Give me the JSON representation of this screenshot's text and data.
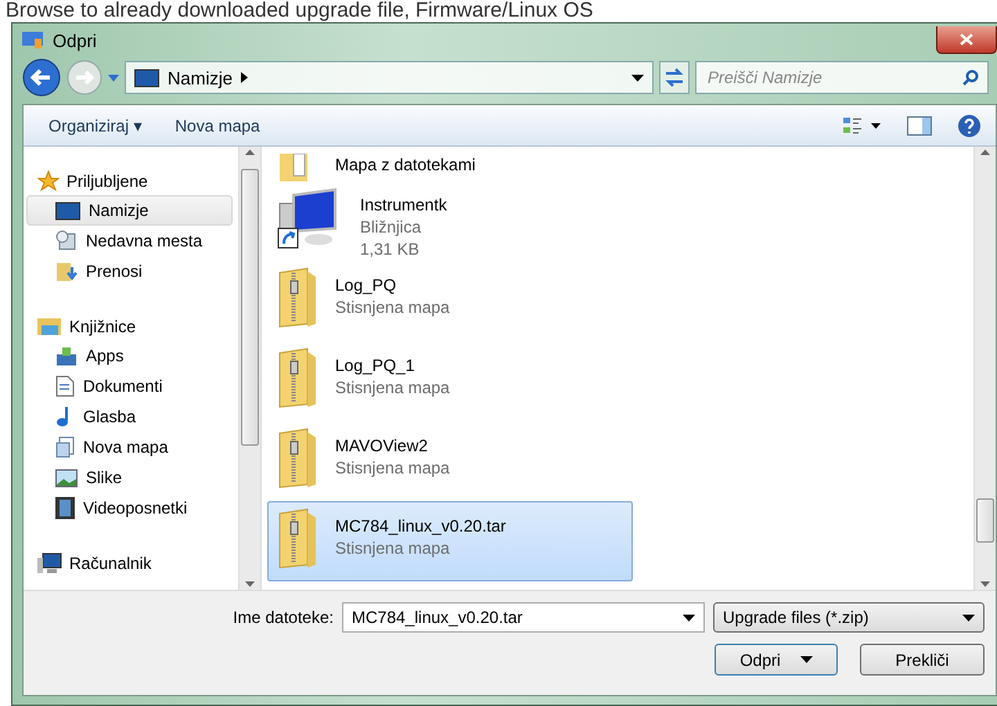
{
  "caption": "Browse to already downloaded upgrade file, Firmware/Linux OS",
  "window": {
    "title": "Odpri"
  },
  "address": {
    "location": "Namizje",
    "search_placeholder": "Preišči Namizje"
  },
  "toolbar": {
    "buttons": [
      "Organiziraj ▾",
      "Nova mapa"
    ]
  },
  "sidebar": {
    "groups": [
      {
        "label": "Priljubljene",
        "kind": "favorites",
        "children": [
          {
            "label": "Namizje",
            "kind": "desktop",
            "selected": true
          },
          {
            "label": "Nedavna mesta",
            "kind": "recent",
            "selected": false
          },
          {
            "label": "Prenosi",
            "kind": "downloads",
            "selected": false
          }
        ]
      },
      {
        "label": "Knjižnice",
        "kind": "libraries",
        "children": [
          {
            "label": "Apps",
            "kind": "apps",
            "selected": false
          },
          {
            "label": "Dokumenti",
            "kind": "documents",
            "selected": false
          },
          {
            "label": "Glasba",
            "kind": "music",
            "selected": false
          },
          {
            "label": "Nova mapa",
            "kind": "library",
            "selected": false
          },
          {
            "label": "Slike",
            "kind": "pictures",
            "selected": false
          },
          {
            "label": "Videoposnetki",
            "kind": "videos",
            "selected": false
          }
        ]
      },
      {
        "label": "Računalnik",
        "kind": "computer"
      }
    ]
  },
  "files": [
    {
      "name": "Mapa z datotekami",
      "kind": "folder",
      "selected": false
    },
    {
      "name": "Instrumentk",
      "kind": "shortcut",
      "details": [
        "Bližnjica",
        "1,31 KB"
      ],
      "selected": false
    },
    {
      "name": "Log_PQ",
      "kind": "zip",
      "details": [
        "Stisnjena mapa"
      ],
      "selected": false
    },
    {
      "name": "Log_PQ_1",
      "kind": "zip",
      "details": [
        "Stisnjena mapa"
      ],
      "selected": false
    },
    {
      "name": "MAVOView2",
      "kind": "zip",
      "details": [
        "Stisnjena mapa"
      ],
      "selected": false
    },
    {
      "name": "MC784_linux_v0.20.tar",
      "kind": "zip",
      "details": [
        "Stisnjena mapa"
      ],
      "selected": true
    }
  ],
  "footer": {
    "filename_label": "Ime datoteke:",
    "filename": "MC784_linux_v0.20.tar",
    "filter": "Upgrade files (*.zip)",
    "open_button": "Odpri",
    "cancel_button": "Prekliči"
  }
}
